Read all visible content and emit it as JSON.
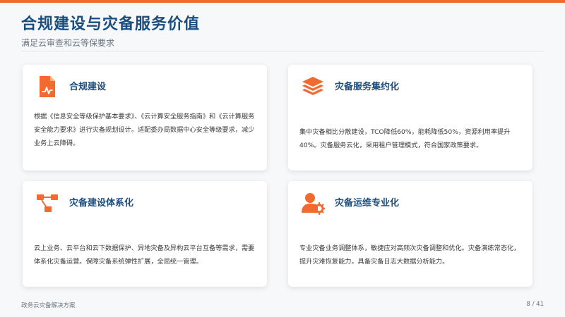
{
  "header": {
    "title": "合规建设与灾备服务价值",
    "subtitle": "满足云审查和云等保要求"
  },
  "cards": [
    {
      "icon": "document-chart-icon",
      "title": "合规建设",
      "description": "根据《信息安全等级保护基本要求》、《云计算安全服务指南》和《云计算服务安全能力要求》进行灾备规划设计。适配委办局数据中心安全等级要求，减少业务上云障碍。"
    },
    {
      "icon": "layers-icon",
      "title": "灾备服务集约化",
      "description": "集中灾备相比分散建设，TCO降低60%，能耗降低50%，资源利用率提升40%。灾备服务云化，采用租户管理模式，符合国家政策要求。"
    },
    {
      "icon": "hierarchy-icon",
      "title": "灾备建设体系化",
      "description": "云上业务、云平台和云下数据保护、异地灾备及异构云平台互备等需求，需要体系化灾备运营。保障灾备系统弹性扩展，全局统一管理。"
    },
    {
      "icon": "user-gear-icon",
      "title": "灾备运维专业化",
      "description": "专业灾备业务调整体系，敏捷应对高频次灾备调整和优化。灾备演练常态化，提升灾难恢复能力。具备灾备日志大数据分析能力。"
    }
  ],
  "footer": {
    "left": "政务云灾备解决方案",
    "page": "8 / 41"
  },
  "colors": {
    "accent": "#f26a2e",
    "title": "#1b4d7e"
  }
}
